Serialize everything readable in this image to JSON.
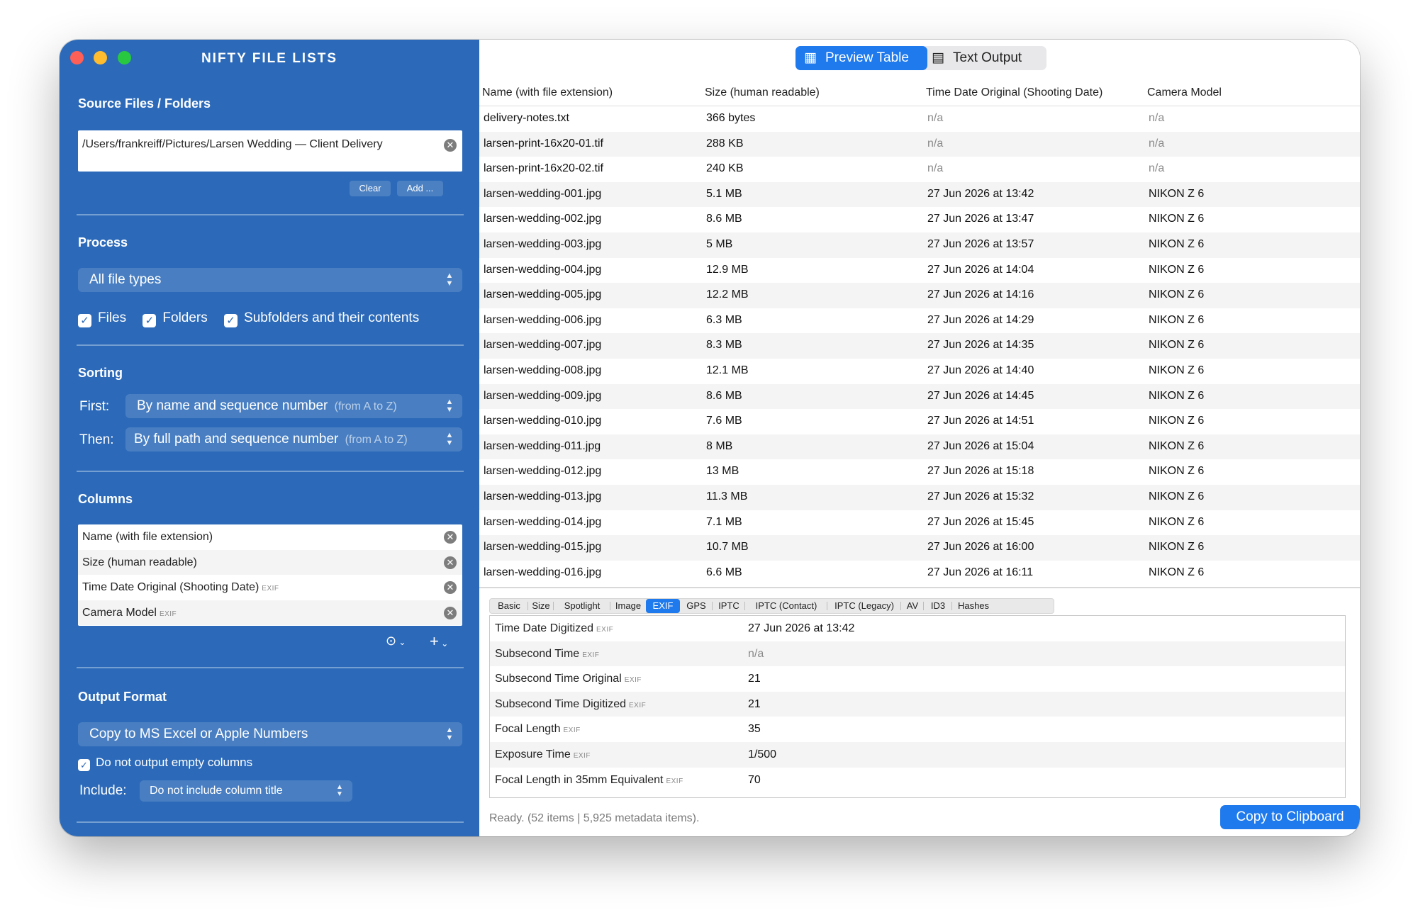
{
  "app": {
    "title": "NIFTY FILE LISTS"
  },
  "sidebar": {
    "source": {
      "title": "Source Files / Folders",
      "path": "/Users/frankreiff/Pictures/Larsen Wedding — Client Delivery",
      "clear_label": "Clear",
      "add_label": "Add ..."
    },
    "process": {
      "title": "Process",
      "file_types": "All file types",
      "options": [
        {
          "label": "Files",
          "checked": true
        },
        {
          "label": "Folders",
          "checked": true
        },
        {
          "label": "Subfolders and their contents",
          "checked": true
        }
      ]
    },
    "sorting": {
      "title": "Sorting",
      "first_label": "First:",
      "first_value": "By name and sequence number",
      "first_hint": "(from A to Z)",
      "then_label": "Then:",
      "then_value": "By full path and sequence number",
      "then_hint": "(from A to Z)"
    },
    "columns": {
      "title": "Columns",
      "items": [
        {
          "name": "Name (with file extension)",
          "tag": ""
        },
        {
          "name": "Size (human readable)",
          "tag": ""
        },
        {
          "name": "Time Date Original (Shooting Date)",
          "tag": "EXIF"
        },
        {
          "name": "Camera Model",
          "tag": "EXIF"
        }
      ]
    },
    "output": {
      "title": "Output Format",
      "format": "Copy to MS Excel or Apple Numbers",
      "skip_empty_label": "Do not output empty columns",
      "skip_empty_checked": true,
      "include_label": "Include:",
      "include_value": "Do not include column title"
    }
  },
  "main": {
    "tabs": [
      {
        "label": "Preview Table",
        "active": true,
        "icon": "table-icon"
      },
      {
        "label": "Text Output",
        "active": false,
        "icon": "document-icon"
      }
    ],
    "table": {
      "columns": [
        "Name (with file extension)",
        "Size (human readable)",
        "Time Date Original (Shooting Date)",
        "Camera Model"
      ],
      "rows": [
        [
          "delivery-notes.txt",
          "366 bytes",
          "n/a",
          "n/a"
        ],
        [
          "larsen-print-16x20-01.tif",
          "288 KB",
          "n/a",
          "n/a"
        ],
        [
          "larsen-print-16x20-02.tif",
          "240 KB",
          "n/a",
          "n/a"
        ],
        [
          "larsen-wedding-001.jpg",
          "5.1 MB",
          "27 Jun 2026 at 13:42",
          "NIKON Z 6"
        ],
        [
          "larsen-wedding-002.jpg",
          "8.6 MB",
          "27 Jun 2026 at 13:47",
          "NIKON Z 6"
        ],
        [
          "larsen-wedding-003.jpg",
          "5 MB",
          "27 Jun 2026 at 13:57",
          "NIKON Z 6"
        ],
        [
          "larsen-wedding-004.jpg",
          "12.9 MB",
          "27 Jun 2026 at 14:04",
          "NIKON Z 6"
        ],
        [
          "larsen-wedding-005.jpg",
          "12.2 MB",
          "27 Jun 2026 at 14:16",
          "NIKON Z 6"
        ],
        [
          "larsen-wedding-006.jpg",
          "6.3 MB",
          "27 Jun 2026 at 14:29",
          "NIKON Z 6"
        ],
        [
          "larsen-wedding-007.jpg",
          "8.3 MB",
          "27 Jun 2026 at 14:35",
          "NIKON Z 6"
        ],
        [
          "larsen-wedding-008.jpg",
          "12.1 MB",
          "27 Jun 2026 at 14:40",
          "NIKON Z 6"
        ],
        [
          "larsen-wedding-009.jpg",
          "8.6 MB",
          "27 Jun 2026 at 14:45",
          "NIKON Z 6"
        ],
        [
          "larsen-wedding-010.jpg",
          "7.6 MB",
          "27 Jun 2026 at 14:51",
          "NIKON Z 6"
        ],
        [
          "larsen-wedding-011.jpg",
          "8 MB",
          "27 Jun 2026 at 15:04",
          "NIKON Z 6"
        ],
        [
          "larsen-wedding-012.jpg",
          "13 MB",
          "27 Jun 2026 at 15:18",
          "NIKON Z 6"
        ],
        [
          "larsen-wedding-013.jpg",
          "11.3 MB",
          "27 Jun 2026 at 15:32",
          "NIKON Z 6"
        ],
        [
          "larsen-wedding-014.jpg",
          "7.1 MB",
          "27 Jun 2026 at 15:45",
          "NIKON Z 6"
        ],
        [
          "larsen-wedding-015.jpg",
          "10.7 MB",
          "27 Jun 2026 at 16:00",
          "NIKON Z 6"
        ],
        [
          "larsen-wedding-016.jpg",
          "6.6 MB",
          "27 Jun 2026 at 16:11",
          "NIKON Z 6"
        ]
      ]
    },
    "detail_tabs": [
      "Basic",
      "Size",
      "Spotlight",
      "Image",
      "EXIF",
      "GPS",
      "IPTC",
      "IPTC (Contact)",
      "IPTC (Legacy)",
      "AV",
      "ID3",
      "Hashes"
    ],
    "detail_active": "EXIF",
    "detail_rows": [
      {
        "key": "Time Date Digitized",
        "tag": "EXIF",
        "value": "27 Jun 2026 at 13:42"
      },
      {
        "key": "Subsecond Time",
        "tag": "EXIF",
        "value": "n/a"
      },
      {
        "key": "Subsecond Time Original",
        "tag": "EXIF",
        "value": "21"
      },
      {
        "key": "Subsecond Time Digitized",
        "tag": "EXIF",
        "value": "21"
      },
      {
        "key": "Focal Length",
        "tag": "EXIF",
        "value": "35"
      },
      {
        "key": "Exposure Time",
        "tag": "EXIF",
        "value": "1/500"
      },
      {
        "key": "Focal Length in 35mm Equivalent",
        "tag": "EXIF",
        "value": "70"
      }
    ],
    "status": "Ready. (52 items | 5,925 metadata items).",
    "copy_label": "Copy to Clipboard"
  },
  "colors": {
    "sidebar_bg": "#2c6ab9",
    "accent": "#1f7aed",
    "traffic_red": "#fe5f57",
    "traffic_yellow": "#febc2e",
    "traffic_green": "#28c840"
  }
}
